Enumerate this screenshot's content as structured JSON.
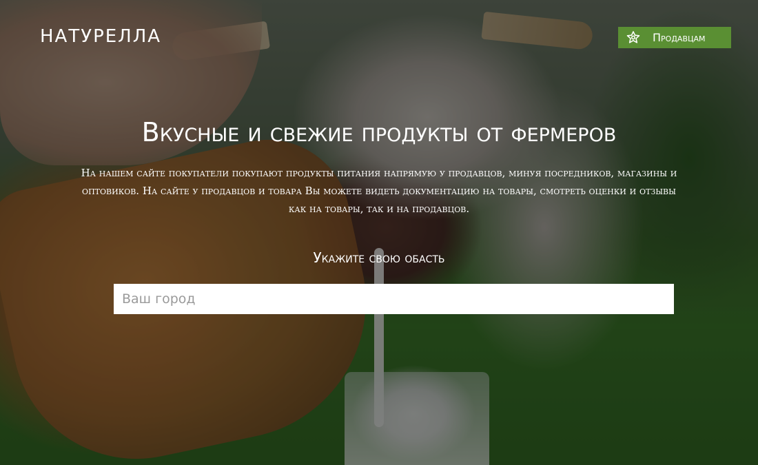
{
  "header": {
    "logo_text": "НАТУРЕЛЛА",
    "sellers_button": {
      "label": "Продавцам",
      "icon": "handshake-icon"
    }
  },
  "hero": {
    "title": "Вкусные и свежие продукты от фермеров",
    "description": "На нашем сайте покупатели покупают продукты питания напрямую у продавцов, минуя посредников, магазины и оптовиков. На сайте у продавцов и товара Вы можете видеть документацию на товары, смотреть оценки и отзывы как на товары, так и на продавцов.",
    "region_prompt": "Укажите свою обасть",
    "city_input": {
      "placeholder": "Ваш город",
      "value": ""
    }
  },
  "colors": {
    "accent_green": "#5a8f33",
    "overlay": "rgba(0,0,0,0.45)",
    "text": "#ffffff"
  }
}
